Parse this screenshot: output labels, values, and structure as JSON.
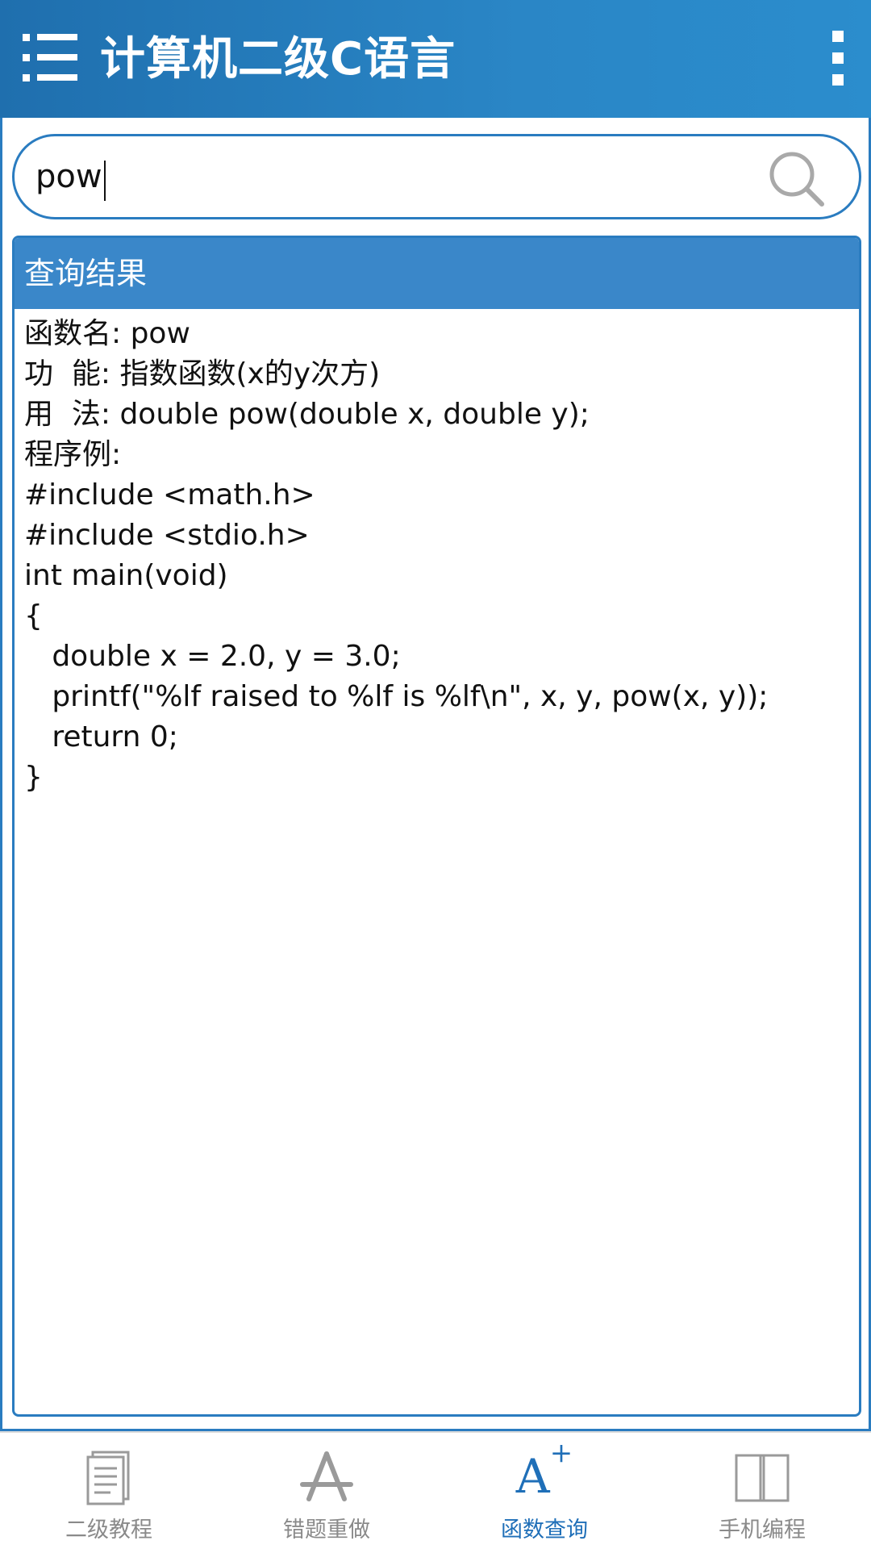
{
  "appbar": {
    "title": "计算机二级C语言"
  },
  "search": {
    "value": "pow"
  },
  "result": {
    "header": "查询结果",
    "lines": [
      "函数名: pow",
      "功  能: 指数函数(x的y次方)",
      "用  法: double pow(double x, double y);",
      "程序例:",
      "#include <math.h>",
      "#include <stdio.h>",
      "int main(void)",
      "{",
      "   double x = 2.0, y = 3.0;",
      "   printf(\"%lf raised to %lf is %lf\\n\", x, y, pow(x, y));",
      "   return 0;",
      "}"
    ]
  },
  "nav": {
    "items": [
      {
        "label": "二级教程",
        "icon": "document-icon"
      },
      {
        "label": "错题重做",
        "icon": "app-store-icon"
      },
      {
        "label": "函数查询",
        "icon": "a-plus-icon",
        "glyph": "A",
        "glyph_sup": "+"
      },
      {
        "label": "手机编程",
        "icon": "book-icon"
      }
    ],
    "active_index": 2
  },
  "colors": {
    "primary": "#2a86c6",
    "primary_dark": "#1f6fae",
    "header_blue": "#3a87c9",
    "border_blue": "#2a7cc0",
    "nav_active": "#1f6fb8",
    "nav_inactive": "#8a8a8a"
  }
}
